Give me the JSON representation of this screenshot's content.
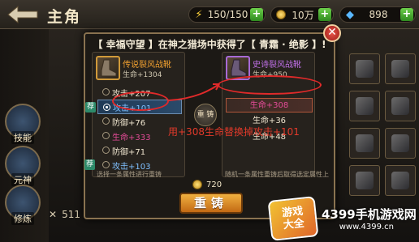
{
  "header": {
    "title": "主角",
    "stamina": "150/150",
    "gold": "10万",
    "diamonds": "898"
  },
  "side_menu": [
    "技能",
    "元神",
    "修炼"
  ],
  "modal": {
    "message": "【 幸福守望 】在神之猎场中获得了【 青霜 · 绝影 】!",
    "left": {
      "name": "传说裂风战靴",
      "sub": "生命+1304",
      "options": [
        {
          "label": "攻击+207",
          "color": "#f0e6d0",
          "tag": ""
        },
        {
          "label": "攻击+101",
          "color": "#7fc0ff",
          "tag": "荐",
          "selected": true
        },
        {
          "label": "防御+76",
          "color": "#f0e6d0",
          "tag": ""
        },
        {
          "label": "生命+333",
          "color": "#e24b96",
          "tag": ""
        },
        {
          "label": "防御+71",
          "color": "#f0e6d0",
          "tag": ""
        },
        {
          "label": "攻击+103",
          "color": "#7fc0ff",
          "tag": "荐"
        }
      ],
      "footer": "选择一条属性进行重铸"
    },
    "swap_label": "重 铸",
    "right": {
      "name": "史诗裂风战靴",
      "sub": "生命+950",
      "rows": [
        {
          "label": "生命+308",
          "color": "#e24b96",
          "highlight": true
        },
        {
          "label": "生命+36",
          "color": "#f0e6d0"
        },
        {
          "label": "生命+48",
          "color": "#f0e6d0"
        }
      ],
      "footer": "随机一条属性重铸后取得选定属性上"
    },
    "gold_cost": "720",
    "recast_label": "重铸",
    "close_label": "✕"
  },
  "annotation": "用+308生命替换掉攻击+101",
  "bottom": {
    "power": "511"
  },
  "watermark": {
    "logo_top": "游戏",
    "logo_bottom": "大全",
    "brand": "4399手机游戏网",
    "url": "www.4399.cn"
  },
  "colors": {
    "accent": "#c36a14",
    "highlight": "#e02a2a"
  }
}
